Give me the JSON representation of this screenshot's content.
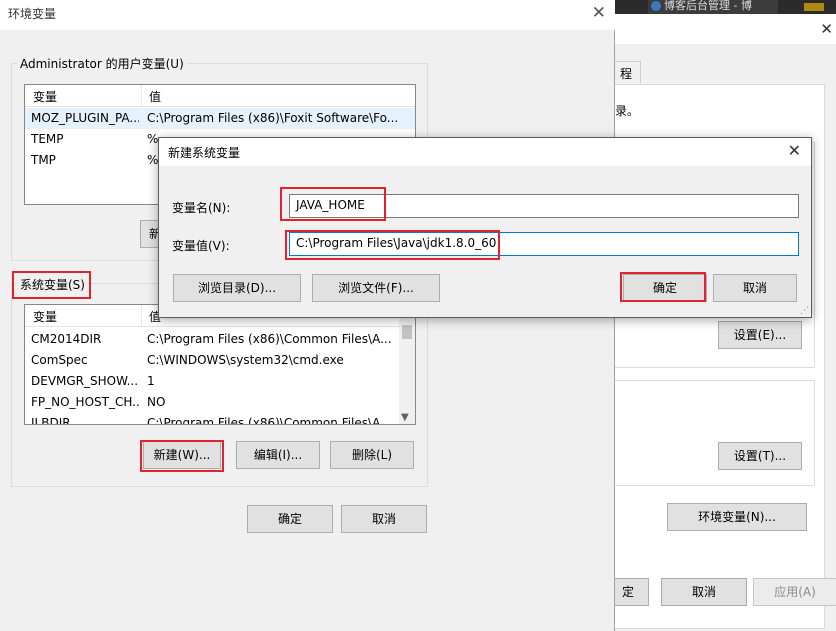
{
  "taskbar": {
    "tab_label": "博客后台管理 - 博"
  },
  "bg_window": {
    "tab_label": "程",
    "text": "录。",
    "settings_btn_1": "设置(E)...",
    "settings_btn_2": "设置(T)...",
    "env_btn": "环境变量(N)...",
    "ok_partial": "定",
    "cancel": "取消",
    "apply": "应用(A)"
  },
  "env_window": {
    "title": "环境变量",
    "user_vars_label": "Administrator 的用户变量(U)",
    "user_vars_header": {
      "name": "变量",
      "value": "值"
    },
    "user_vars": [
      {
        "name": "MOZ_PLUGIN_PA...",
        "value": "C:\\Program Files (x86)\\Foxit Software\\Fo..."
      },
      {
        "name": "TEMP",
        "value": "%"
      },
      {
        "name": "TMP",
        "value": "%"
      }
    ],
    "user_new_partial": "新",
    "system_vars_label": "系统变量(S)",
    "system_vars_header": {
      "name": "变量",
      "value": "值"
    },
    "system_vars": [
      {
        "name": "CM2014DIR",
        "value": "C:\\Program Files (x86)\\Common Files\\A..."
      },
      {
        "name": "ComSpec",
        "value": "C:\\WINDOWS\\system32\\cmd.exe"
      },
      {
        "name": "DEVMGR_SHOW...",
        "value": "1"
      },
      {
        "name": "FP_NO_HOST_CH...",
        "value": "NO"
      },
      {
        "name": "ILBDIR",
        "value": "C:\\Program Files (x86)\\Common Files\\A..."
      }
    ],
    "new_btn": "新建(W)...",
    "edit_btn": "编辑(I)...",
    "delete_btn": "删除(L)",
    "ok_btn": "确定",
    "cancel_btn": "取消"
  },
  "new_var_dialog": {
    "title": "新建系统变量",
    "name_label": "变量名(N):",
    "name_value": "JAVA_HOME",
    "value_label": "变量值(V):",
    "value_value": "C:\\Program Files\\Java\\jdk1.8.0_60",
    "browse_dir_btn": "浏览目录(D)...",
    "browse_file_btn": "浏览文件(F)...",
    "ok_btn": "确定",
    "cancel_btn": "取消"
  },
  "colors": {
    "highlight_box": "#e0232e",
    "focus_border": "#0078d7"
  }
}
